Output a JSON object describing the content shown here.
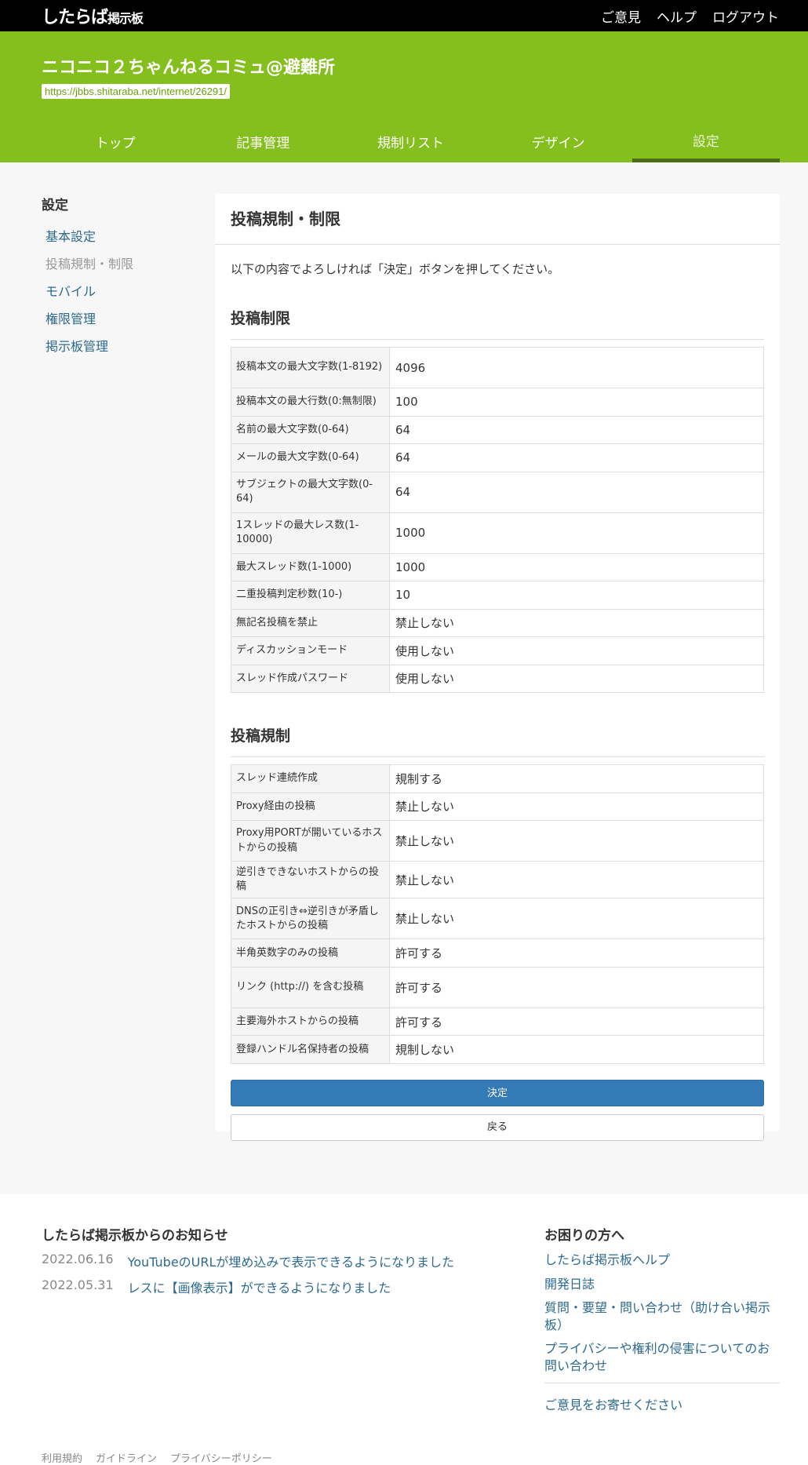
{
  "brand": {
    "logo_main": "したらば",
    "logo_sub": "掲示板"
  },
  "topnav": [
    "ご意見",
    "ヘルプ",
    "ログアウト"
  ],
  "board": {
    "title": "ニコニコ２ちゃんねるコミュ@避難所",
    "url": "https://jbbs.shitaraba.net/internet/26291/"
  },
  "tabs": [
    "トップ",
    "記事管理",
    "規制リスト",
    "デザイン",
    "設定"
  ],
  "sidebar": {
    "title": "設定",
    "items": [
      "基本設定",
      "投稿規制・制限",
      "モバイル",
      "権限管理",
      "掲示板管理"
    ]
  },
  "panel": {
    "title": "投稿規制・制限",
    "notice": "以下の内容でよろしければ「決定」ボタンを押してください。",
    "section1": {
      "title": "投稿制限",
      "rows": [
        {
          "k": "投稿本文の最大文字数(1-8192)",
          "v": "4096"
        },
        {
          "k": "投稿本文の最大行数(0:無制限)",
          "v": "100"
        },
        {
          "k": "名前の最大文字数(0-64)",
          "v": "64"
        },
        {
          "k": "メールの最大文字数(0-64)",
          "v": "64"
        },
        {
          "k": "サブジェクトの最大文字数(0-64)",
          "v": "64"
        },
        {
          "k": "1スレッドの最大レス数(1-10000)",
          "v": "1000"
        },
        {
          "k": "最大スレッド数(1-1000)",
          "v": "1000"
        },
        {
          "k": "二重投稿判定秒数(10-)",
          "v": "10"
        },
        {
          "k": "無記名投稿を禁止",
          "v": "禁止しない"
        },
        {
          "k": "ディスカッションモード",
          "v": "使用しない"
        },
        {
          "k": "スレッド作成パスワード",
          "v": "使用しない"
        }
      ]
    },
    "section2": {
      "title": "投稿規制",
      "rows": [
        {
          "k": "スレッド連続作成",
          "v": "規制する"
        },
        {
          "k": "Proxy経由の投稿",
          "v": "禁止しない"
        },
        {
          "k": "Proxy用PORTが開いているホストからの投稿",
          "v": "禁止しない"
        },
        {
          "k": "逆引きできないホストからの投稿",
          "v": "禁止しない"
        },
        {
          "k": "DNSの正引き⇔逆引きが矛盾したホストからの投稿",
          "v": "禁止しない"
        },
        {
          "k": "半角英数字のみの投稿",
          "v": "許可する"
        },
        {
          "k": "リンク (http://) を含む投稿",
          "v": "許可する"
        },
        {
          "k": "主要海外ホストからの投稿",
          "v": "許可する"
        },
        {
          "k": "登録ハンドル名保持者の投稿",
          "v": "規制しない"
        }
      ]
    },
    "submit_label": "決定",
    "back_label": "戻る"
  },
  "footer": {
    "news_title": "したらば掲示板からのお知らせ",
    "news": [
      {
        "date": "2022.06.16",
        "text": "YouTubeのURLが埋め込みで表示できるようになりました"
      },
      {
        "date": "2022.05.31",
        "text": "レスに【画像表示】ができるようになりました"
      }
    ],
    "help_title": "お困りの方へ",
    "help_links": [
      "したらば掲示板ヘルプ",
      "開発日誌",
      "質問・要望・問い合わせ（助け合い掲示板）",
      "プライバシーや権利の侵害についてのお問い合わせ"
    ],
    "feedback": "ご意見をお寄せください",
    "links": [
      "利用規約",
      "ガイドライン",
      "プライバシーポリシー"
    ]
  }
}
